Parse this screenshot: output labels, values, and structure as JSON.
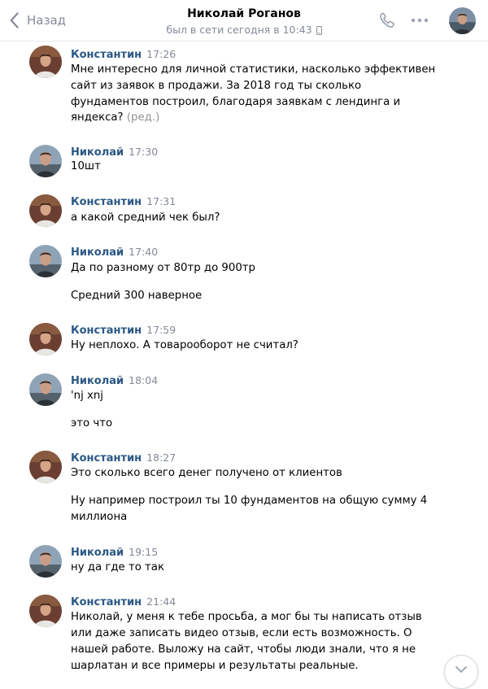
{
  "header": {
    "back_label": "Назад",
    "title": "Николай Роганов",
    "status": "был в сети сегодня в 10:43"
  },
  "messages": [
    {
      "author": "Константин",
      "time": "17:26",
      "lines": [
        "Мне интересно для личной статистики, насколько эффективен",
        "сайт из заявок в продажи. За 2018 год ты сколько",
        "фундаментов построил, благодаря заявкам с лендинга и",
        "яндекса?"
      ],
      "edited": "(ред.)"
    },
    {
      "author": "Николай",
      "time": "17:30",
      "lines": [
        "10шт"
      ]
    },
    {
      "author": "Константин",
      "time": "17:31",
      "lines": [
        "а какой средний чек был?"
      ]
    },
    {
      "author": "Николай",
      "time": "17:40",
      "lines": [
        "Да по разному от 80тр до 900тр",
        "Средний 300 наверное"
      ]
    },
    {
      "author": "Константин",
      "time": "17:59",
      "lines": [
        "Ну неплохо. А товарооборот не считал?"
      ]
    },
    {
      "author": "Николай",
      "time": "18:04",
      "lines": [
        "'nj xnj",
        "это что"
      ]
    },
    {
      "author": "Константин",
      "time": "18:27",
      "lines": [
        "Это сколько всего денег получено от клиентов",
        "Ну например построил ты 10 фундаментов на общую сумму 4",
        "миллиона"
      ]
    },
    {
      "author": "Николай",
      "time": "19:15",
      "lines": [
        "ну да где то так"
      ]
    },
    {
      "author": "Константин",
      "time": "21:44",
      "lines": [
        "Николай, у меня к тебе просьба, а мог бы ты написать отзыв",
        "или даже записать видео отзыв, если есть возможность. О",
        "нашей работе. Выложу на сайт, чтобы люди знали, что я не",
        "шарлатан и все примеры и результаты реальные."
      ]
    }
  ],
  "colors": {
    "author_name": "#2a5885",
    "muted": "#828a99",
    "divider": "#e7e8ec"
  },
  "icons": [
    "back-chevron-icon",
    "phone-icon",
    "more-icon",
    "mobile-icon",
    "chevron-down-icon"
  ]
}
